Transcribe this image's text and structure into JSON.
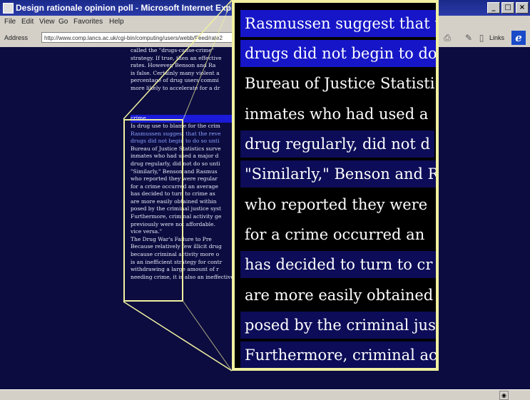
{
  "window": {
    "title": "Design rationale opinion poll - Microsoft Internet Explorer",
    "controls": {
      "minimize": "_",
      "maximize": "□",
      "close": "×"
    }
  },
  "menu": [
    "File",
    "Edit",
    "View",
    "Go",
    "Favorites",
    "Help"
  ],
  "address_bar": {
    "label": "Address",
    "url": "http://www.comp.lancs.ac.uk/cgi-bin/computing/users/webb/Feed/rate2",
    "links_label": "Links"
  },
  "document": {
    "lines": [
      "called the \"drugs-cause-crime\"",
      "strategy. If true, then an effective",
      "rates. However, Benson and Ra",
      "is false. Certainly many violent a",
      "percentage of drug users commi",
      "more likely to accelerate for a dr",
      "",
      "",
      "",
      "crime.",
      "Is drug use to blame for the crim",
      "Rasmussen suggest that the reve",
      "drugs did not begin to do so unti",
      "Bureau of Justice Statistics surve",
      "inmates who had used a major d",
      "drug regularly, did not do so unti",
      "\"Similarly,\" Benson and Rasmus",
      "who reported they were regular",
      "for a crime occurred an average",
      "has decided to turn to crime as",
      "are more easily obtained within",
      "posed by the criminal justice syst",
      "Furthermore, criminal activity ge",
      "previously were not affordable.",
      "vice versa.\"",
      "The Drug War's Failure to Pre",
      "Because relatively few illicit drug",
      "because criminal activity more o",
      "is an inefficient strategy for contr",
      "withdrawing a large amount of r",
      "needing crime, it is also an ineffective, often counterproductive, strategy for fighting"
    ]
  },
  "magnifier": {
    "lines": [
      "Rasmussen suggest that t",
      "drugs did not begin to do",
      "Bureau of Justice Statisti",
      "inmates who had used a ",
      "drug regularly, did not d",
      "\"Similarly,\" Benson and R",
      "who reported they were",
      "for a crime occurred an",
      "has decided to turn to cr",
      "are more easily obtained",
      "posed by the criminal jus",
      "Furthermore, criminal ac"
    ]
  },
  "colors": {
    "page_background": "#0c0c40",
    "highlight": "#1a1ad8",
    "magnifier_border": "#f0f0a0"
  }
}
